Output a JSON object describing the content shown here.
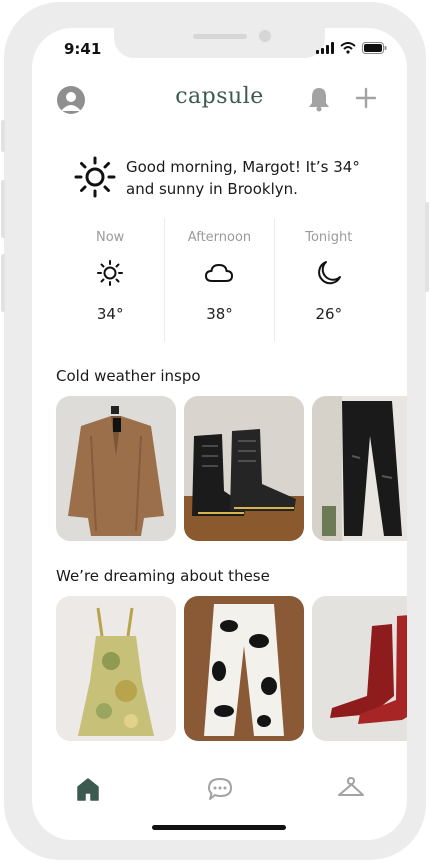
{
  "status": {
    "time": "9:41"
  },
  "header": {
    "logo": "capsule"
  },
  "greeting": {
    "text": "Good morning, Margot! It’s 34° and sunny in Brooklyn."
  },
  "forecast": [
    {
      "label": "Now",
      "icon": "sun-icon",
      "temp": "34°"
    },
    {
      "label": "Afternoon",
      "icon": "cloud-icon",
      "temp": "38°"
    },
    {
      "label": "Tonight",
      "icon": "moon-icon",
      "temp": "26°"
    }
  ],
  "sections": [
    {
      "title": "Cold weather inspo",
      "items": [
        "brown faux fur coat",
        "black lace-up combat boots",
        "black leather pants"
      ]
    },
    {
      "title": "We’re dreaming about these",
      "items": [
        "floral mesh slip dress",
        "cow print pants",
        "red heeled boots"
      ]
    }
  ],
  "tabs": [
    {
      "icon": "home-icon",
      "active": true
    },
    {
      "icon": "chat-icon",
      "active": false
    },
    {
      "icon": "hanger-icon",
      "active": false
    }
  ],
  "colors": {
    "accent": "#3c5a50",
    "frame": "#ececec",
    "icon_gray": "#a3a3a3"
  }
}
